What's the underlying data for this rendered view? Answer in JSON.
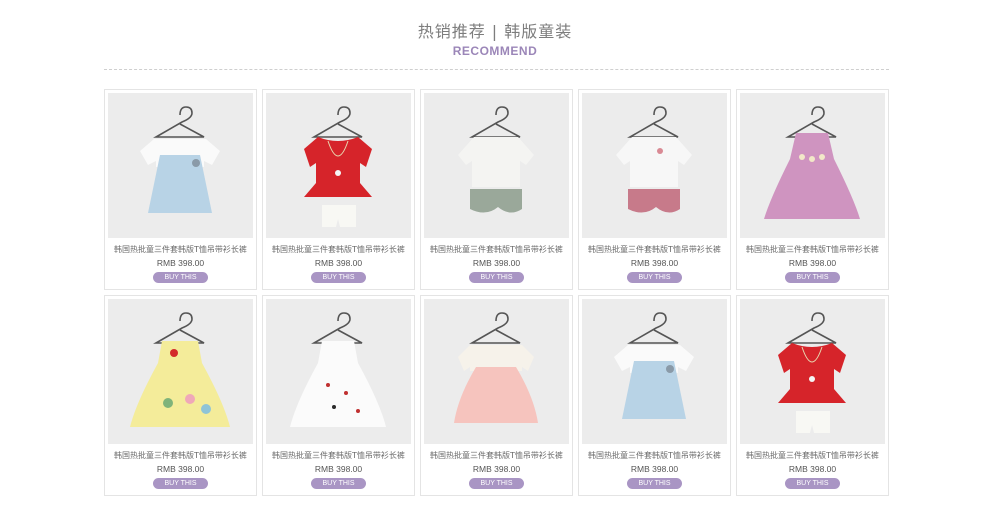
{
  "header": {
    "title_cn": "热销推荐 | 韩版童装",
    "title_en": "RECOMMEND"
  },
  "colors": {
    "accent": "#a995c4",
    "title_en": "#9b86b8"
  },
  "products": [
    {
      "name": "韩国热批童三件套韩版T恤吊带衫长裤",
      "price": "RMB 398.00",
      "button": "BUY THIS",
      "image": "blue-dress-with-white-tshirt"
    },
    {
      "name": "韩国热批童三件套韩版T恤吊带衫长裤",
      "price": "RMB 398.00",
      "button": "BUY THIS",
      "image": "red-top-with-white-shorts"
    },
    {
      "name": "韩国热批童三件套韩版T恤吊带衫长裤",
      "price": "RMB 398.00",
      "button": "BUY THIS",
      "image": "white-top-with-green-shorts"
    },
    {
      "name": "韩国热批童三件套韩版T恤吊带衫长裤",
      "price": "RMB 398.00",
      "button": "BUY THIS",
      "image": "white-top-with-pink-shorts"
    },
    {
      "name": "韩国热批童三件套韩版T恤吊带衫长裤",
      "price": "RMB 398.00",
      "button": "BUY THIS",
      "image": "pink-plaid-dress"
    },
    {
      "name": "韩国热批童三件套韩版T恤吊带衫长裤",
      "price": "RMB 398.00",
      "button": "BUY THIS",
      "image": "yellow-floral-dress"
    },
    {
      "name": "韩国热批童三件套韩版T恤吊带衫长裤",
      "price": "RMB 398.00",
      "button": "BUY THIS",
      "image": "white-bow-print-dress"
    },
    {
      "name": "韩国热批童三件套韩版T恤吊带衫长裤",
      "price": "RMB 398.00",
      "button": "BUY THIS",
      "image": "peach-dress-with-white-top"
    },
    {
      "name": "韩国热批童三件套韩版T恤吊带衫长裤",
      "price": "RMB 398.00",
      "button": "BUY THIS",
      "image": "blue-dress-with-white-tshirt"
    },
    {
      "name": "韩国热批童三件套韩版T恤吊带衫长裤",
      "price": "RMB 398.00",
      "button": "BUY THIS",
      "image": "red-top-with-white-shorts"
    }
  ]
}
